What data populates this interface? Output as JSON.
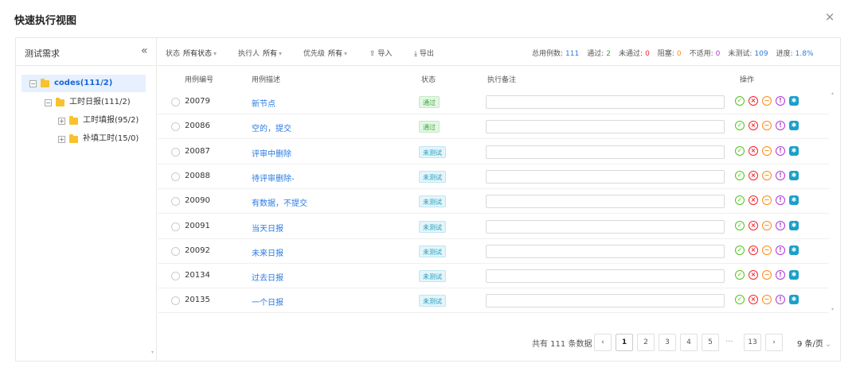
{
  "dialog": {
    "title": "快速执行视图",
    "close_label": "×"
  },
  "left": {
    "title": "测试需求",
    "collapse_label": "«",
    "tree": [
      {
        "label": "codes(111/2)",
        "toggle": "−",
        "selected": true
      },
      {
        "label": "工时日报(111/2)",
        "toggle": "−"
      },
      {
        "label": "工时填报(95/2)",
        "toggle": "+"
      },
      {
        "label": "补填工时(15/0)",
        "toggle": "+"
      }
    ]
  },
  "toolbar": {
    "status_label": "状态",
    "status_value": "所有状态",
    "executor_label": "执行人",
    "executor_value": "所有",
    "priority_label": "优先级",
    "priority_value": "所有",
    "import_label": "导入",
    "export_label": "导出",
    "caret": "▾"
  },
  "stats": {
    "total_label": "总用例数:",
    "total": "111",
    "pass_label": "通过:",
    "pass": "2",
    "fail_label": "未通过:",
    "fail": "0",
    "block_label": "阻塞:",
    "block": "0",
    "na_label": "不适用:",
    "na": "0",
    "untested_label": "未测试:",
    "untested": "109",
    "progress_label": "进度:",
    "progress": "1.8%",
    "colors": {
      "total": "#2a7ae2",
      "pass": "#3aa63a",
      "fail": "#f5222d",
      "block": "#fa8c16",
      "na": "#b037d6",
      "untested": "#2a7ae2",
      "progress": "#2a7ae2"
    }
  },
  "table": {
    "headers": {
      "id": "用例编号",
      "desc": "用例描述",
      "status": "状态",
      "note": "执行备注",
      "ops": "操作"
    },
    "rows": [
      {
        "id": "20079",
        "desc": "新节点",
        "status": "通过",
        "kind": "pass"
      },
      {
        "id": "20086",
        "desc": "空的，提交",
        "status": "通过",
        "kind": "pass"
      },
      {
        "id": "20087",
        "desc": "评审中删除",
        "status": "未测试",
        "kind": "untested"
      },
      {
        "id": "20088",
        "desc": "待评审删除-",
        "status": "未测试",
        "kind": "untested"
      },
      {
        "id": "20090",
        "desc": "有数据，不提交",
        "status": "未测试",
        "kind": "untested"
      },
      {
        "id": "20091",
        "desc": "当天日报",
        "status": "未测试",
        "kind": "untested"
      },
      {
        "id": "20092",
        "desc": "未来日报",
        "status": "未测试",
        "kind": "untested"
      },
      {
        "id": "20134",
        "desc": "过去日报",
        "status": "未测试",
        "kind": "untested"
      },
      {
        "id": "20135",
        "desc": "一个日报",
        "status": "未测试",
        "kind": "untested"
      }
    ],
    "ops_icons": [
      "check-circle-icon",
      "x-circle-icon",
      "minus-circle-icon",
      "info-circle-icon",
      "bug-icon"
    ],
    "ops_glyphs": [
      "✓",
      "×",
      "−",
      "!",
      "✱"
    ]
  },
  "pagination": {
    "total_text": "共有 111 条数据",
    "prev": "‹",
    "next": "›",
    "pages": [
      "1",
      "2",
      "3",
      "4",
      "5"
    ],
    "dots": "···",
    "last": "13",
    "page_size": "9 条/页",
    "page_size_caret": "⌄"
  }
}
